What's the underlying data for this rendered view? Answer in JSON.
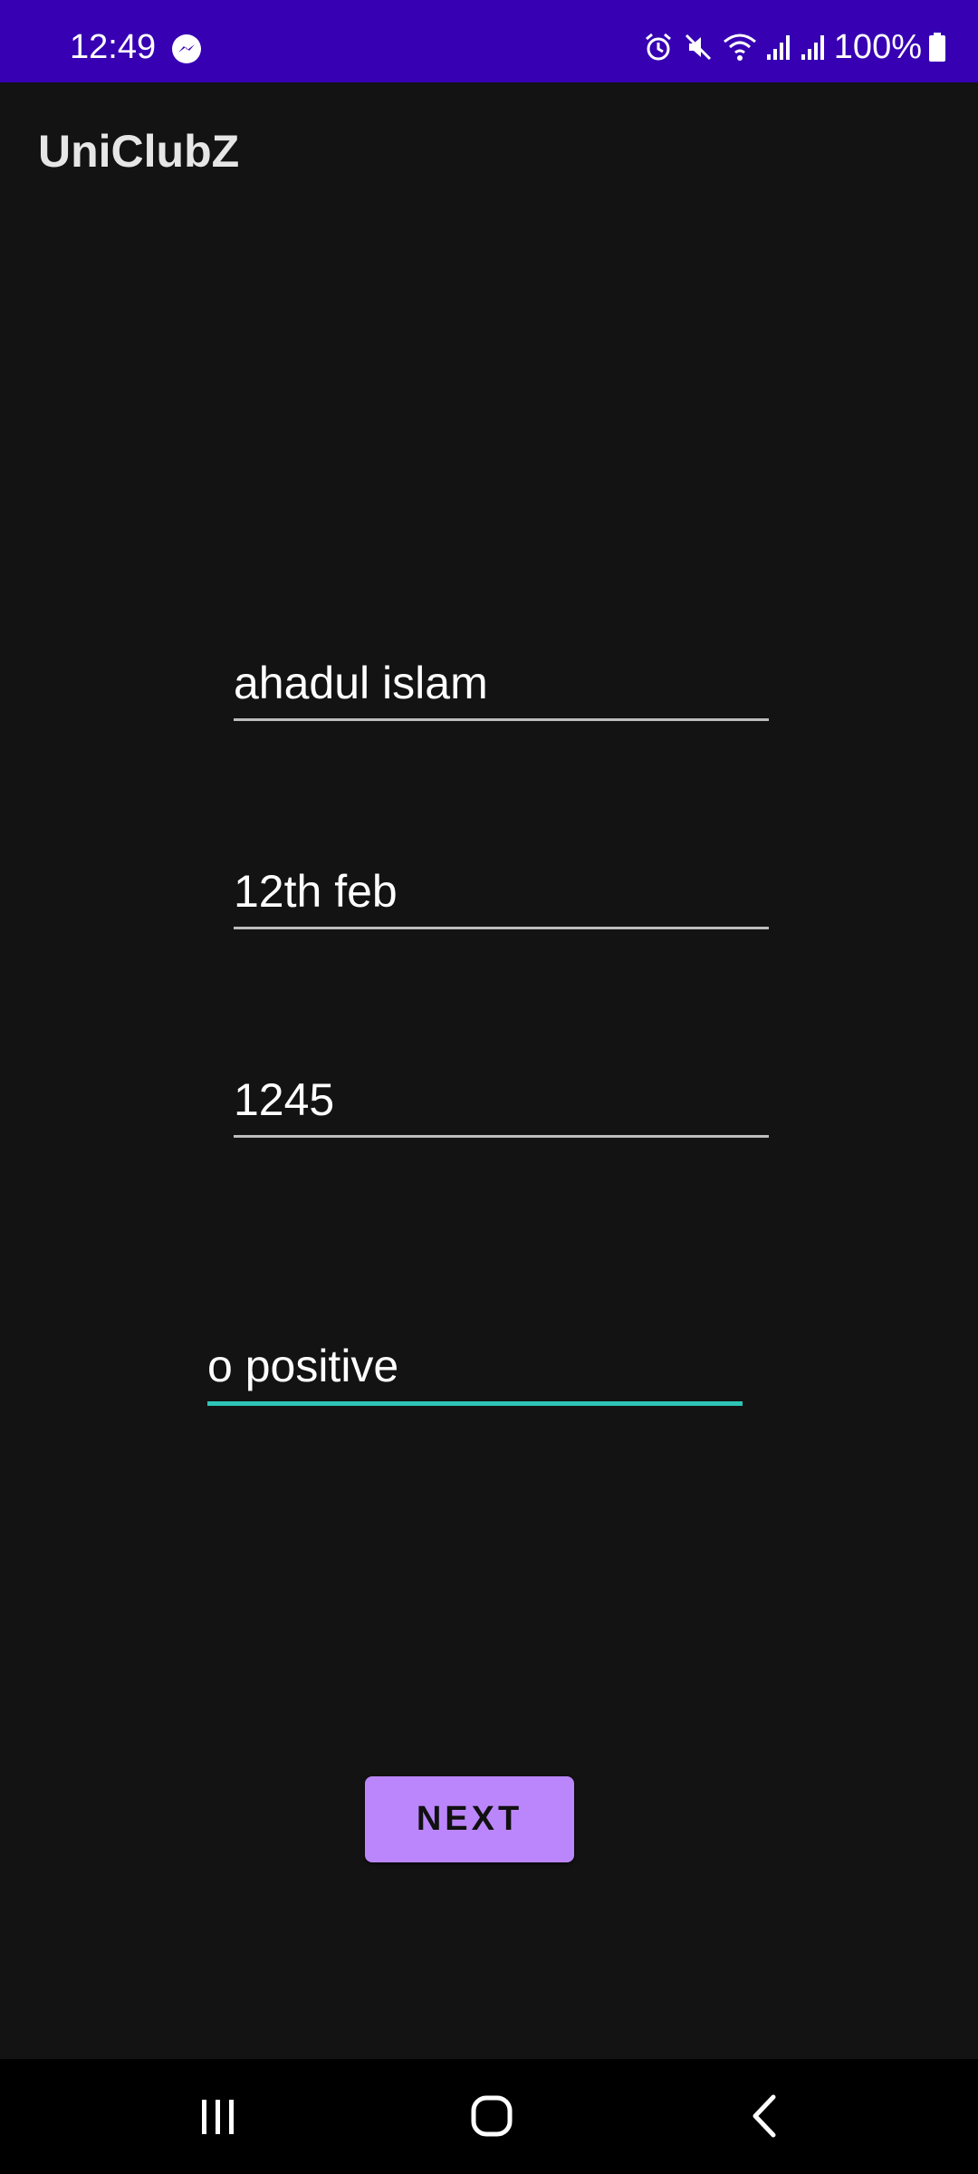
{
  "status_bar": {
    "time": "12:49",
    "battery_text": "100%",
    "icons": [
      "messenger-icon",
      "alarm-icon",
      "mute-icon",
      "wifi-icon",
      "signal-icon",
      "signal-icon",
      "battery-icon"
    ]
  },
  "app_bar": {
    "title": "UniClubZ"
  },
  "form": {
    "name_value": "ahadul islam",
    "dob_value": "12th feb",
    "id_value": "1245",
    "blood_group_value": "o positive"
  },
  "next_button": {
    "label": "NEXT"
  },
  "colors": {
    "status_bar": "#3700b3",
    "background": "#131313",
    "button": "#bb86fc",
    "focus_underline": "#2ec4b6"
  }
}
